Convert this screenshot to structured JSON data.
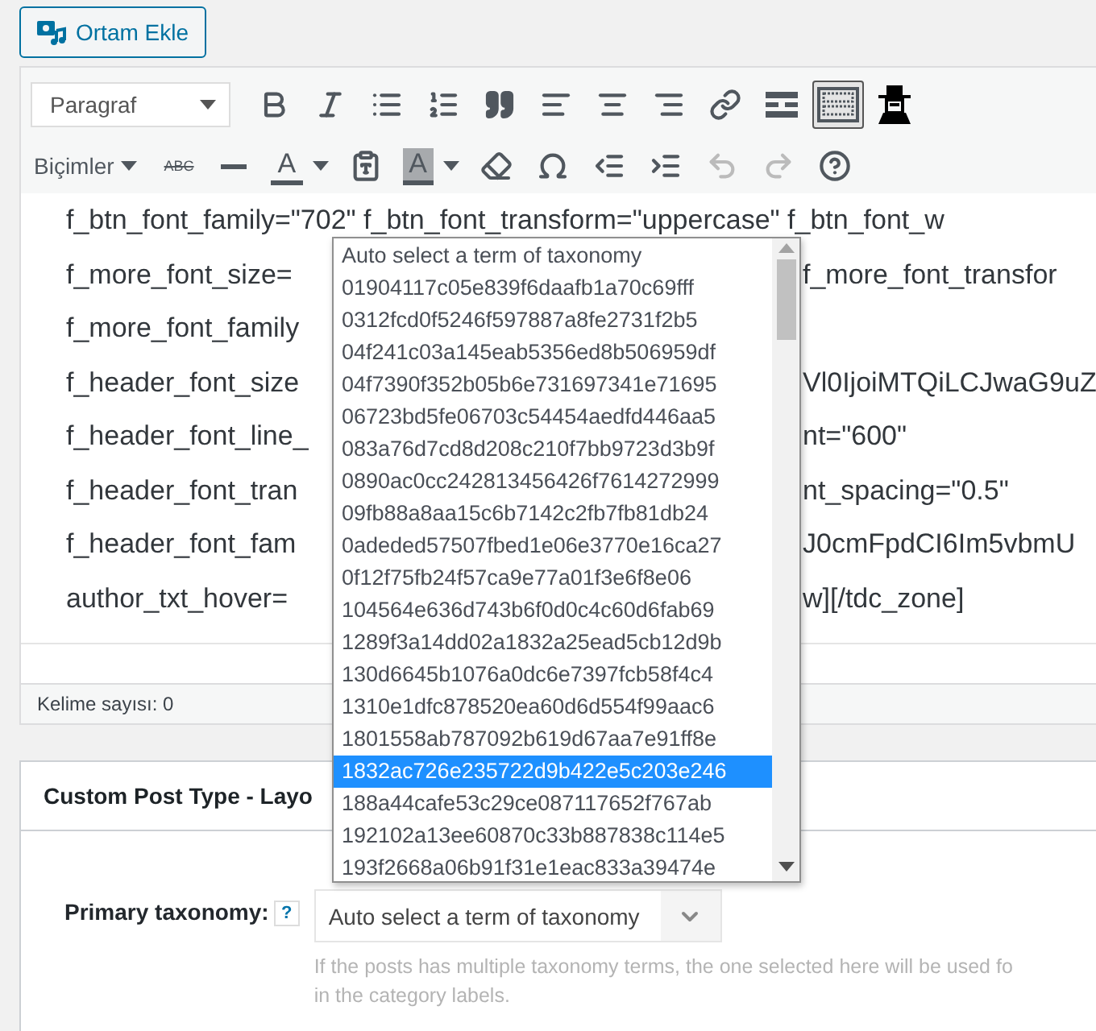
{
  "media_button": {
    "label": "Ortam Ekle"
  },
  "toolbar_rows": [
    {
      "items": [
        {
          "kind": "select",
          "label": "Paragraf"
        },
        {
          "kind": "bold",
          "pressed": false,
          "disabled": false
        },
        {
          "kind": "italic",
          "pressed": false,
          "disabled": false
        },
        {
          "kind": "bullet-list",
          "pressed": false,
          "disabled": false
        },
        {
          "kind": "numbered-list",
          "pressed": false,
          "disabled": false
        },
        {
          "kind": "quote",
          "pressed": false,
          "disabled": false
        },
        {
          "kind": "align-left",
          "pressed": false,
          "disabled": false
        },
        {
          "kind": "align-center",
          "pressed": false,
          "disabled": false
        },
        {
          "kind": "align-right",
          "pressed": false,
          "disabled": false
        },
        {
          "kind": "link",
          "pressed": false,
          "disabled": false
        },
        {
          "kind": "read-more",
          "pressed": false,
          "disabled": false
        },
        {
          "kind": "toolbar-toggle",
          "pressed": true,
          "disabled": false
        },
        {
          "kind": "hat-figure",
          "pressed": false,
          "disabled": false
        }
      ]
    },
    {
      "items": [
        {
          "kind": "menu",
          "label": "Biçimler"
        },
        {
          "kind": "strike",
          "label": "ABC",
          "pressed": false,
          "disabled": false
        },
        {
          "kind": "horizontal-line",
          "pressed": false,
          "disabled": false
        },
        {
          "kind": "text-color",
          "label": "A",
          "pressed": false,
          "disabled": false
        },
        {
          "kind": "paste-text",
          "pressed": false,
          "disabled": false
        },
        {
          "kind": "background-color",
          "label": "A",
          "pressed": false,
          "disabled": false
        },
        {
          "kind": "eraser",
          "pressed": false,
          "disabled": false
        },
        {
          "kind": "omega",
          "pressed": false,
          "disabled": false
        },
        {
          "kind": "outdent",
          "pressed": false,
          "disabled": false
        },
        {
          "kind": "indent",
          "pressed": false,
          "disabled": false
        },
        {
          "kind": "undo",
          "pressed": false,
          "disabled": true
        },
        {
          "kind": "redo",
          "pressed": false,
          "disabled": true
        },
        {
          "kind": "help",
          "pressed": false,
          "disabled": false
        }
      ]
    }
  ],
  "content_lines": [
    {
      "left": "f_btn_font_family=\"702\" f_btn_font_transform=\"uppercase\" f_btn_font_w"
    },
    {
      "left": "f_more_font_size=",
      "right": "f_more_font_transfor"
    },
    {
      "left": "f_more_font_family"
    },
    {
      "left": "f_header_font_size",
      "right": "Vl0IjoiMTQiLCJwaG9uZ"
    },
    {
      "left": "f_header_font_line_",
      "right": "nt=\"600\""
    },
    {
      "left": "f_header_font_tran",
      "right": "nt_spacing=\"0.5\""
    },
    {
      "left": "f_header_font_fam",
      "right": "J0cmFpdCI6Im5vbmU"
    },
    {
      "left": "author_txt_hover=",
      "right": "w][/tdc_zone]"
    }
  ],
  "status_bar": {
    "word_count": "Kelime sayısı: 0"
  },
  "metabox": {
    "title": "Custom Post Type - Layo",
    "field": {
      "label": "Primary taxonomy:",
      "help": "?",
      "value": "Auto select a term of taxonomy",
      "description": [
        "If the posts has multiple taxonomy terms, the one selected here will be used fo",
        "in the category labels."
      ]
    }
  },
  "dropdown": {
    "options": [
      {
        "label": "Auto select a term of taxonomy",
        "selected": false
      },
      {
        "label": "01904117c05e839f6daafb1a70c69fff",
        "selected": false
      },
      {
        "label": "0312fcd0f5246f597887a8fe2731f2b5",
        "selected": false
      },
      {
        "label": "04f241c03a145eab5356ed8b506959df",
        "selected": false
      },
      {
        "label": "04f7390f352b05b6e731697341e71695",
        "selected": false
      },
      {
        "label": "06723bd5fe06703c54454aedfd446aa5",
        "selected": false
      },
      {
        "label": "083a76d7cd8d208c210f7bb9723d3b9f",
        "selected": false
      },
      {
        "label": "0890ac0cc242813456426f7614272999",
        "selected": false
      },
      {
        "label": "09fb88a8aa15c6b7142c2fb7fb81db24",
        "selected": false
      },
      {
        "label": "0adeded57507fbed1e06e3770e16ca27",
        "selected": false
      },
      {
        "label": "0f12f75fb24f57ca9e77a01f3e6f8e06",
        "selected": false
      },
      {
        "label": "104564e636d743b6f0d0c4c60d6fab69",
        "selected": false
      },
      {
        "label": "1289f3a14dd02a1832a25ead5cb12d9b",
        "selected": false
      },
      {
        "label": "130d6645b1076a0dc6e7397fcb58f4c4",
        "selected": false
      },
      {
        "label": "1310e1dfc878520ea60d6d554f99aac6",
        "selected": false
      },
      {
        "label": "1801558ab787092b619d67aa7e91ff8e",
        "selected": false
      },
      {
        "label": "1832ac726e235722d9b422e5c203e246",
        "selected": true
      },
      {
        "label": "188a44cafe53c29ce087117652f767ab",
        "selected": false
      },
      {
        "label": "192102a13ee60870c33b887838c114e5",
        "selected": false
      },
      {
        "label": "193f2668a06b91f31e1eac833a39474e",
        "selected": false
      }
    ]
  }
}
